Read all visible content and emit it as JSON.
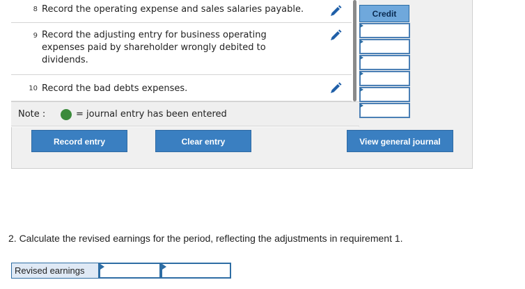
{
  "entries": [
    {
      "num": "8",
      "text": "Record the operating expense and sales salaries payable."
    },
    {
      "num": "9",
      "text": "Record the adjusting entry for business operating expenses paid by shareholder wrongly debited to dividends."
    },
    {
      "num": "10",
      "text": "Record the bad debts expenses."
    }
  ],
  "note": {
    "label": "Note :",
    "desc": "= journal entry has been entered",
    "dot_color": "#3a8a3a"
  },
  "journal": {
    "credit_header": "Credit"
  },
  "buttons": {
    "record": "Record entry",
    "clear": "Clear entry",
    "view": "View general journal"
  },
  "question": "2. Calculate the revised earnings for the period, reflecting the adjustments in requirement 1.",
  "revised": {
    "label": "Revised earnings",
    "value1": "",
    "value2": ""
  },
  "icons": {
    "edit": "pencil-icon"
  },
  "colors": {
    "button": "#3a7fc1",
    "credit_header": "#6fa8dc",
    "border": "#2e6da4"
  }
}
